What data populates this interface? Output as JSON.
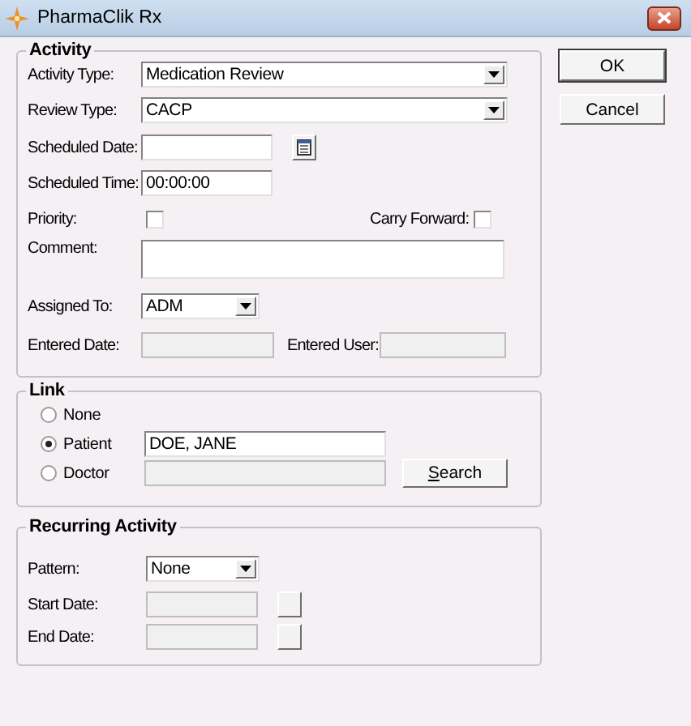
{
  "window": {
    "title": "PharmaClik Rx"
  },
  "activity": {
    "title": "Activity",
    "activity_type": {
      "label": "Activity Type:",
      "value": "Medication Review"
    },
    "review_type": {
      "label": "Review Type:",
      "value": "CACP"
    },
    "scheduled_date": {
      "label": "Scheduled Date:"
    },
    "scheduled_time": {
      "label": "Scheduled Time:",
      "value": "00:00:00"
    },
    "priority": {
      "label": "Priority:",
      "checked": false
    },
    "carry_forward": {
      "label": "Carry Forward:",
      "checked": false
    },
    "comment": {
      "label": "Comment:"
    },
    "assigned_to": {
      "label": "Assigned To:",
      "value": "ADM"
    },
    "entered_date": {
      "label": "Entered Date:",
      "disabled": true
    },
    "entered_user": {
      "label": "Entered User:",
      "disabled": true
    }
  },
  "link": {
    "title": "Link",
    "options": [
      {
        "label": "None",
        "selected": false
      },
      {
        "label": "Patient",
        "selected": true,
        "value": "DOE, JANE",
        "disabled": false
      },
      {
        "label": "Doctor",
        "selected": false,
        "disabled": true
      }
    ],
    "search_button": {
      "label": "Search",
      "mnemonic_underlined": true
    }
  },
  "recurring": {
    "title": "Recurring Activity",
    "pattern": {
      "label": "Pattern:",
      "value": "None"
    },
    "start_date": {
      "label": "Start Date:",
      "disabled": true
    },
    "end_date": {
      "label": "End Date:",
      "disabled": true
    }
  },
  "buttons": [
    {
      "label": "OK",
      "default": true
    },
    {
      "label": "Cancel",
      "default": false
    }
  ]
}
